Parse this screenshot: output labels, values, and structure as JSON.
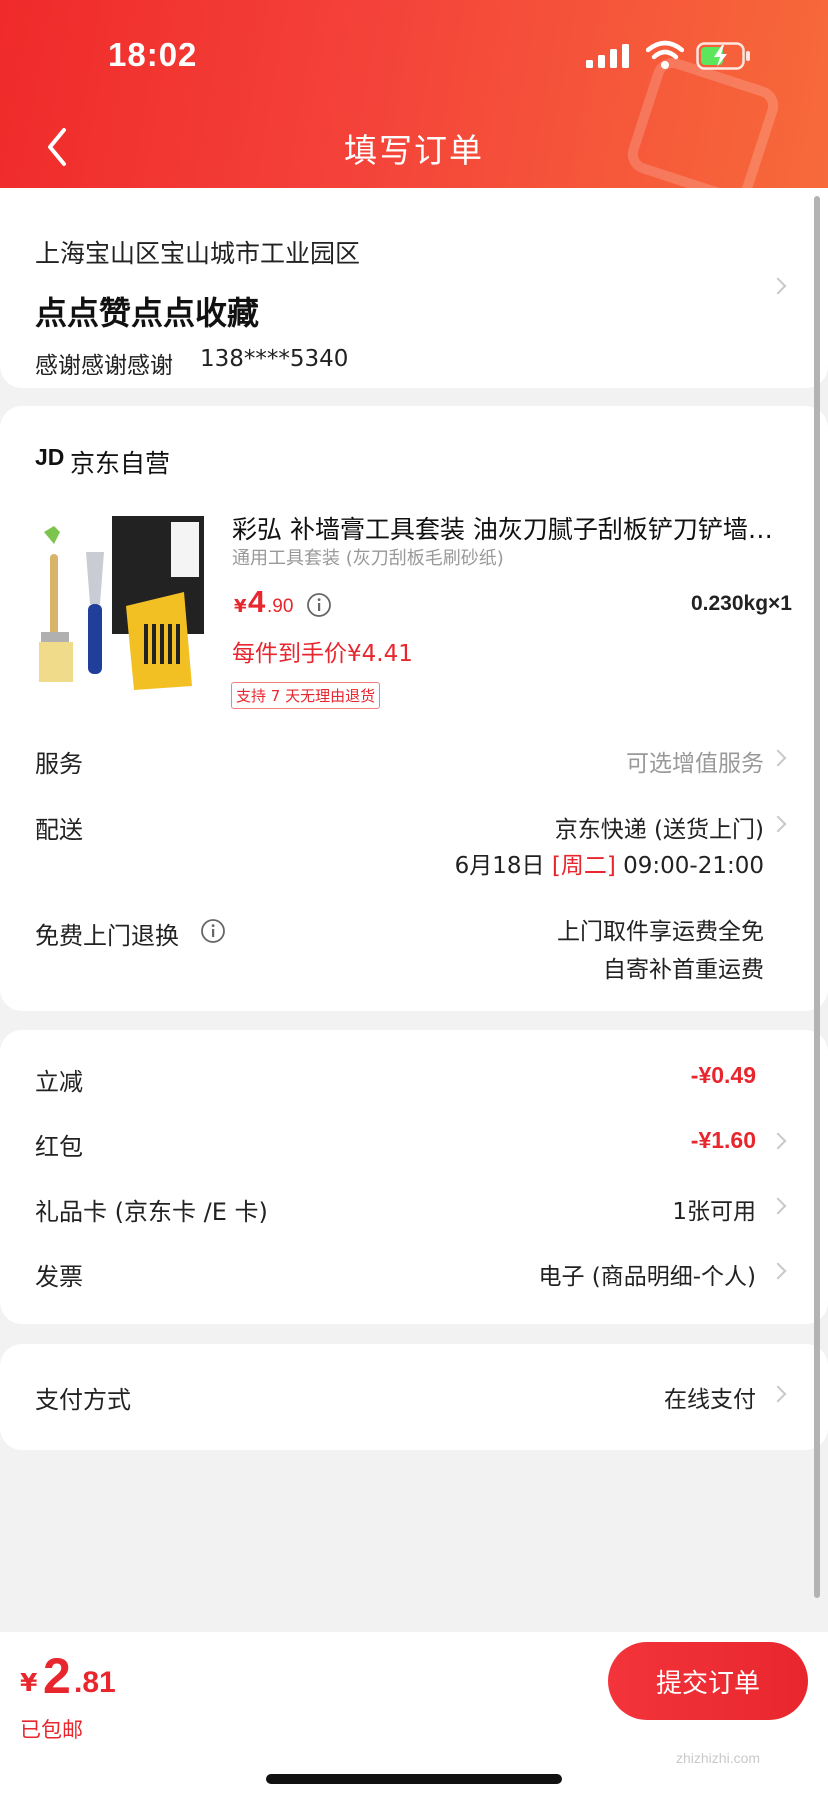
{
  "status_bar": {
    "time": "18:02"
  },
  "header": {
    "title": "填写订单",
    "back_icon": "chevron-left-icon"
  },
  "address": {
    "region": "上海宝山区宝山城市工业园区",
    "detail": "点点赞点点收藏",
    "recipient": "感谢感谢感谢",
    "phone": "138****5340"
  },
  "shop": {
    "logo": "JD",
    "name": "京东自营"
  },
  "product": {
    "title": "彩弘 补墙膏工具套装 油灰刀腻子刮板铲刀铲墙…",
    "spec": "通用工具套装 (灰刀刮板毛刷砂纸)",
    "price_currency": "¥",
    "price_integer": "4",
    "price_decimal": ".90",
    "weight_qty": "0.230kg×1",
    "unit_price": "每件到手价¥4.41",
    "return_badge": "支持 7 天无理由退货"
  },
  "services": {
    "service_label": "服务",
    "service_value": "可选增值服务",
    "delivery_label": "配送",
    "delivery_value": "京东快递 (送货上门)",
    "delivery_date": "6月18日",
    "delivery_weekday": "[周二]",
    "delivery_time": "09:00-21:00",
    "free_return_label": "免费上门退换",
    "free_return_line1": "上门取件享运费全免",
    "free_return_line2": "自寄补首重运费"
  },
  "discounts": {
    "instant_label": "立减",
    "instant_value": "-¥0.49",
    "redpacket_label": "红包",
    "redpacket_value": "-¥1.60",
    "giftcard_label": "礼品卡 (京东卡 /E 卡)",
    "giftcard_value": "1张可用",
    "invoice_label": "发票",
    "invoice_value": "电子 (商品明细-个人)"
  },
  "payment": {
    "label": "支付方式",
    "value": "在线支付"
  },
  "footer": {
    "total_currency": "¥",
    "total_integer": "2",
    "total_decimal": ".81",
    "shipping_note": "已包邮",
    "submit_label": "提交订单",
    "watermark": "zhizhizhi.com"
  },
  "colors": {
    "accent": "#e8262e",
    "header_start": "#f02a2a",
    "header_end": "#f76a3a",
    "background": "#f2f2f2"
  }
}
